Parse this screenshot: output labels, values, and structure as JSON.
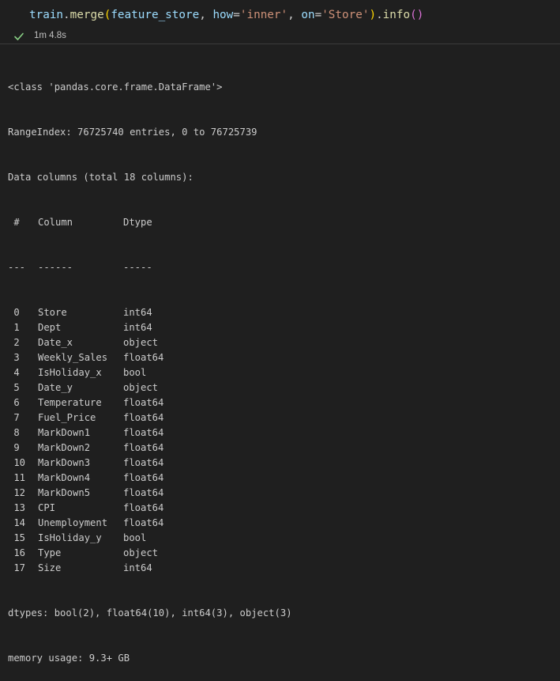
{
  "cell": {
    "code": {
      "obj": "train",
      "dot1": ".",
      "method": "merge",
      "open1": "(",
      "arg1": "feature_store",
      "comma1": ", ",
      "kw1": "how",
      "eq1": "=",
      "val1": "'inner'",
      "comma2": ", ",
      "kw2": "on",
      "eq2": "=",
      "val2": "'Store'",
      "close1": ")",
      "dot2": ".",
      "method2": "info",
      "open2": "(",
      "close2": ")"
    },
    "status": {
      "icon": "check-icon",
      "time": "1m 4.8s",
      "color": "#89d185"
    }
  },
  "output": {
    "header": [
      "<class 'pandas.core.frame.DataFrame'>",
      "RangeIndex: 76725740 entries, 0 to 76725739",
      "Data columns (total 18 columns):"
    ],
    "table_header": {
      "idx": " #",
      "name": "Column",
      "dtype": "Dtype"
    },
    "table_rule": {
      "idx": "---",
      "name": "------",
      "dtype": "-----"
    },
    "columns": [
      {
        "idx": " 0",
        "name": "Store",
        "dtype": "int64"
      },
      {
        "idx": " 1",
        "name": "Dept",
        "dtype": "int64"
      },
      {
        "idx": " 2",
        "name": "Date_x",
        "dtype": "object"
      },
      {
        "idx": " 3",
        "name": "Weekly_Sales",
        "dtype": "float64"
      },
      {
        "idx": " 4",
        "name": "IsHoliday_x",
        "dtype": "bool"
      },
      {
        "idx": " 5",
        "name": "Date_y",
        "dtype": "object"
      },
      {
        "idx": " 6",
        "name": "Temperature",
        "dtype": "float64"
      },
      {
        "idx": " 7",
        "name": "Fuel_Price",
        "dtype": "float64"
      },
      {
        "idx": " 8",
        "name": "MarkDown1",
        "dtype": "float64"
      },
      {
        "idx": " 9",
        "name": "MarkDown2",
        "dtype": "float64"
      },
      {
        "idx": " 10",
        "name": "MarkDown3",
        "dtype": "float64"
      },
      {
        "idx": " 11",
        "name": "MarkDown4",
        "dtype": "float64"
      },
      {
        "idx": " 12",
        "name": "MarkDown5",
        "dtype": "float64"
      },
      {
        "idx": " 13",
        "name": "CPI",
        "dtype": "float64"
      },
      {
        "idx": " 14",
        "name": "Unemployment",
        "dtype": "float64"
      },
      {
        "idx": " 15",
        "name": "IsHoliday_y",
        "dtype": "bool"
      },
      {
        "idx": " 16",
        "name": "Type",
        "dtype": "object"
      },
      {
        "idx": " 17",
        "name": "Size",
        "dtype": "int64"
      }
    ],
    "footer": [
      "dtypes: bool(2), float64(10), int64(3), object(3)",
      "memory usage: 9.3+ GB"
    ]
  }
}
